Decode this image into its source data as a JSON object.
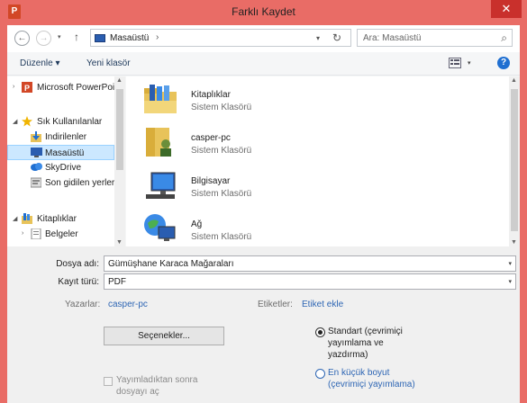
{
  "window": {
    "title": "Farklı Kaydet",
    "app_icon": "P",
    "close": "✕"
  },
  "nav": {
    "back": "←",
    "forward": "→",
    "recent": "▾",
    "up": "↑",
    "address": "Masaüstü",
    "address_sep": "›",
    "address_dropdown": "▾",
    "refresh": "↻",
    "search_placeholder": "Ara: Masaüstü",
    "search_icon": "⌕"
  },
  "toolbar": {
    "organize": "Düzenle ▾",
    "new_folder": "Yeni klasör",
    "view_dropdown": "▾",
    "help": "?"
  },
  "sidebar": {
    "items": [
      {
        "label": "Microsoft PowerPoint",
        "icon": "powerpoint-icon",
        "arrow": "›"
      },
      {
        "label": "Sık Kullanılanlar",
        "icon": "star-icon",
        "arrow": "◢"
      },
      {
        "label": "İndirilenler",
        "icon": "downloads-icon",
        "arrow": ""
      },
      {
        "label": "Masaüstü",
        "icon": "desktop-icon",
        "arrow": ""
      },
      {
        "label": "SkyDrive",
        "icon": "skydrive-icon",
        "arrow": ""
      },
      {
        "label": "Son gidilen yerler",
        "icon": "recent-places-icon",
        "arrow": ""
      },
      {
        "label": "Kitaplıklar",
        "icon": "libraries-icon",
        "arrow": "◢"
      },
      {
        "label": "Belgeler",
        "icon": "documents-icon",
        "arrow": "›"
      }
    ],
    "scroll_up": "▲",
    "scroll_down": "▼"
  },
  "files": {
    "items": [
      {
        "name": "Kitaplıklar",
        "type": "Sistem Klasörü",
        "icon": "libraries-folder-icon"
      },
      {
        "name": "casper-pc",
        "type": "Sistem Klasörü",
        "icon": "user-folder-icon"
      },
      {
        "name": "Bilgisayar",
        "type": "Sistem Klasörü",
        "icon": "computer-icon"
      },
      {
        "name": "Ağ",
        "type": "Sistem Klasörü",
        "icon": "network-icon"
      }
    ],
    "scroll_up": "▲",
    "scroll_down": "▼"
  },
  "form": {
    "filename_label": "Dosya adı:",
    "filename_value": "Gümüşhane Karaca Mağaraları",
    "filetype_label": "Kayıt türü:",
    "filetype_value": "PDF",
    "dropdown_glyph": "▾",
    "author_label": "Yazarlar:",
    "author_value": "casper-pc",
    "tags_label": "Etiketler:",
    "tags_value": "Etiket ekle",
    "options_button": "Seçenekler...",
    "open_after_label": "Yayımladıktan sonra dosyayı aç",
    "open_after_checked": false,
    "optimize_standard": "Standart (çevrimiçi yayımlama ve yazdırma)",
    "optimize_minimum": "En küçük boyut (çevrimiçi yayımlama)",
    "optimize_selected": "standard"
  },
  "colors": {
    "frame": "#e96c66",
    "close": "#c9302c",
    "link": "#2e66b4",
    "selection": "#cce8ff"
  }
}
